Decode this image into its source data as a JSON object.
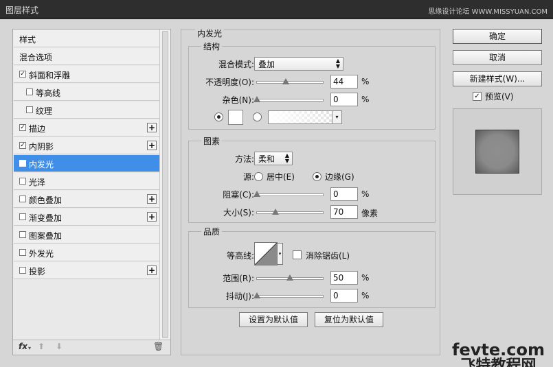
{
  "window": {
    "title": "图层样式",
    "watermark": "思缘设计论坛 WWW.MISSYUAN.COM"
  },
  "styles_list": [
    {
      "label": "样式",
      "checkbox": false,
      "indent": false,
      "checked": false,
      "plus": false,
      "selected": false
    },
    {
      "label": "混合选项",
      "checkbox": false,
      "indent": false,
      "checked": false,
      "plus": false,
      "selected": false
    },
    {
      "label": "斜面和浮雕",
      "checkbox": true,
      "indent": false,
      "checked": true,
      "plus": false,
      "selected": false
    },
    {
      "label": "等高线",
      "checkbox": true,
      "indent": true,
      "checked": false,
      "plus": false,
      "selected": false
    },
    {
      "label": "纹理",
      "checkbox": true,
      "indent": true,
      "checked": false,
      "plus": false,
      "selected": false
    },
    {
      "label": "描边",
      "checkbox": true,
      "indent": false,
      "checked": true,
      "plus": true,
      "selected": false
    },
    {
      "label": "内阴影",
      "checkbox": true,
      "indent": false,
      "checked": true,
      "plus": true,
      "selected": false
    },
    {
      "label": "内发光",
      "checkbox": true,
      "indent": false,
      "checked": true,
      "plus": false,
      "selected": true
    },
    {
      "label": "光泽",
      "checkbox": true,
      "indent": false,
      "checked": false,
      "plus": false,
      "selected": false
    },
    {
      "label": "颜色叠加",
      "checkbox": true,
      "indent": false,
      "checked": false,
      "plus": true,
      "selected": false
    },
    {
      "label": "渐变叠加",
      "checkbox": true,
      "indent": false,
      "checked": false,
      "plus": true,
      "selected": false
    },
    {
      "label": "图案叠加",
      "checkbox": true,
      "indent": false,
      "checked": false,
      "plus": false,
      "selected": false
    },
    {
      "label": "外发光",
      "checkbox": true,
      "indent": false,
      "checked": false,
      "plus": false,
      "selected": false
    },
    {
      "label": "投影",
      "checkbox": true,
      "indent": false,
      "checked": false,
      "plus": true,
      "selected": false
    }
  ],
  "toolbar": {
    "fx": "fx",
    "fx_arrow": "▾",
    "up": "⬆",
    "down": "⬇",
    "trash": "🗑"
  },
  "inner_glow": {
    "title": "内发光",
    "structure": {
      "title": "结构",
      "blend_label": "混合模式:",
      "blend_value": "叠加",
      "opacity_label": "不透明度(O):",
      "opacity_value": "44",
      "opacity_unit": "%",
      "opacity_level": 0.44,
      "noise_label": "杂色(N):",
      "noise_value": "0",
      "noise_unit": "%",
      "noise_level": 0.0
    },
    "elements": {
      "title": "图素",
      "method_label": "方法:",
      "method_value": "柔和",
      "source_label": "源:",
      "source_center": "居中(E)",
      "source_edge": "边缘(G)",
      "source_selected": "edge",
      "choke_label": "阻塞(C):",
      "choke_value": "0",
      "choke_unit": "%",
      "choke_level": 0.0,
      "size_label": "大小(S):",
      "size_value": "70",
      "size_unit": "像素",
      "size_level": 0.28
    },
    "quality": {
      "title": "品质",
      "contour_label": "等高线:",
      "antialias_label": "消除锯齿(L)",
      "antialias_checked": false,
      "range_label": "范围(R):",
      "range_value": "50",
      "range_unit": "%",
      "range_level": 0.5,
      "jitter_label": "抖动(J):",
      "jitter_value": "0",
      "jitter_unit": "%",
      "jitter_level": 0.0
    },
    "default_set": "设置为默认值",
    "default_reset": "复位为默认值"
  },
  "buttons": {
    "ok": "确定",
    "cancel": "取消",
    "new_style": "新建样式(W)...",
    "preview_label": "预览(V)",
    "preview_checked": true
  },
  "brand": {
    "line1": "fevte.com",
    "line2": "飞特教程网"
  }
}
